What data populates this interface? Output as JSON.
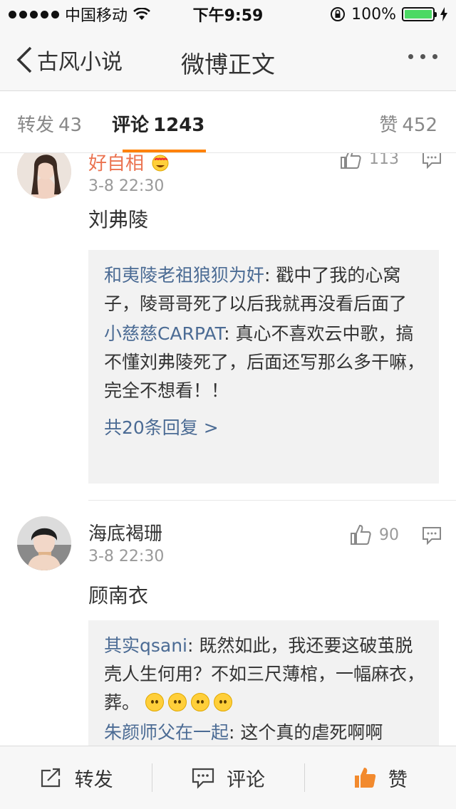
{
  "status_bar": {
    "carrier": "中国移动",
    "time": "下午9:59",
    "battery": "100%",
    "battery_level": 1.0
  },
  "nav": {
    "back_label": "古风小说",
    "title": "微博正文"
  },
  "tabs": {
    "repost": {
      "label": "转发",
      "count": "43"
    },
    "comment": {
      "label": "评论",
      "count": "1243"
    },
    "like": {
      "label": "赞",
      "count": "452"
    }
  },
  "comments": [
    {
      "username": "好自相",
      "time": "3-8 22:30",
      "likes": "113",
      "text": "刘弗陵",
      "replies": [
        {
          "user": "和夷陵老祖狼狈为奸",
          "text": ": 戳中了我的心窝子，陵哥哥死了以后我就再没看后面了"
        },
        {
          "user": "小慈慈CARPAT",
          "text": ": 真心不喜欢云中歌，搞不懂刘弗陵死了，后面还写那么多干嘛，完全不想看！！"
        }
      ],
      "more": "共20条回复 >"
    },
    {
      "username": "海底褐珊",
      "time": "3-8 22:30",
      "likes": "90",
      "text": "顾南衣",
      "replies": [
        {
          "user": "其实qsani",
          "text": ": 既然如此，我还要这破茧脱壳人生何用？不如三尺薄棺，一幅麻衣，葬。"
        },
        {
          "user": "朱颜师父在一起",
          "text": ": 这个真的虐死啊啊"
        }
      ]
    }
  ],
  "toolbar": {
    "repost": "转发",
    "comment": "评论",
    "like": "赞"
  },
  "colors": {
    "accent": "#ff8200",
    "link": "#4b6b94",
    "username_highlight": "#eb7350"
  }
}
